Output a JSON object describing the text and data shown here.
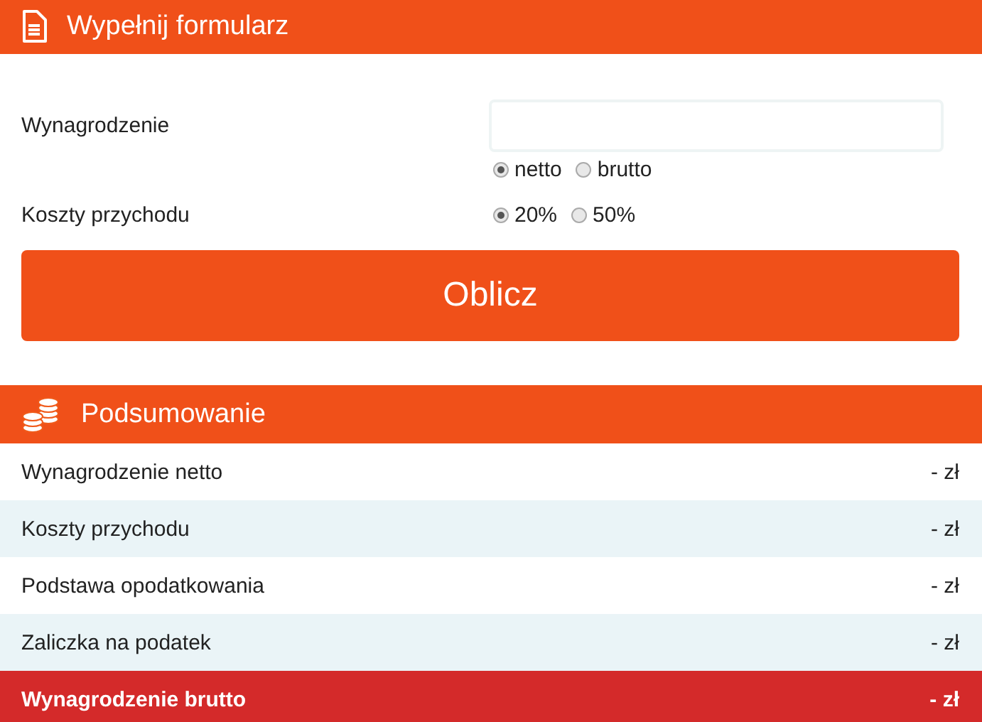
{
  "form_header": {
    "title": "Wypełnij formularz"
  },
  "salary": {
    "label": "Wynagrodzenie",
    "options": [
      {
        "label": "netto",
        "selected": true
      },
      {
        "label": "brutto",
        "selected": false
      }
    ]
  },
  "costs": {
    "label": "Koszty przychodu",
    "options": [
      {
        "label": "20%",
        "selected": true
      },
      {
        "label": "50%",
        "selected": false
      }
    ]
  },
  "submit_button": "Oblicz",
  "summary_header": {
    "title": "Podsumowanie"
  },
  "summary_rows": [
    {
      "label": "Wynagrodzenie netto",
      "value": "- zł",
      "highlighted": false
    },
    {
      "label": "Koszty przychodu",
      "value": "- zł",
      "highlighted": false
    },
    {
      "label": "Podstawa opodatkowania",
      "value": "- zł",
      "highlighted": false
    },
    {
      "label": "Zaliczka na podatek",
      "value": "- zł",
      "highlighted": false
    },
    {
      "label": "Wynagrodzenie brutto",
      "value": "- zł",
      "highlighted": true
    }
  ]
}
